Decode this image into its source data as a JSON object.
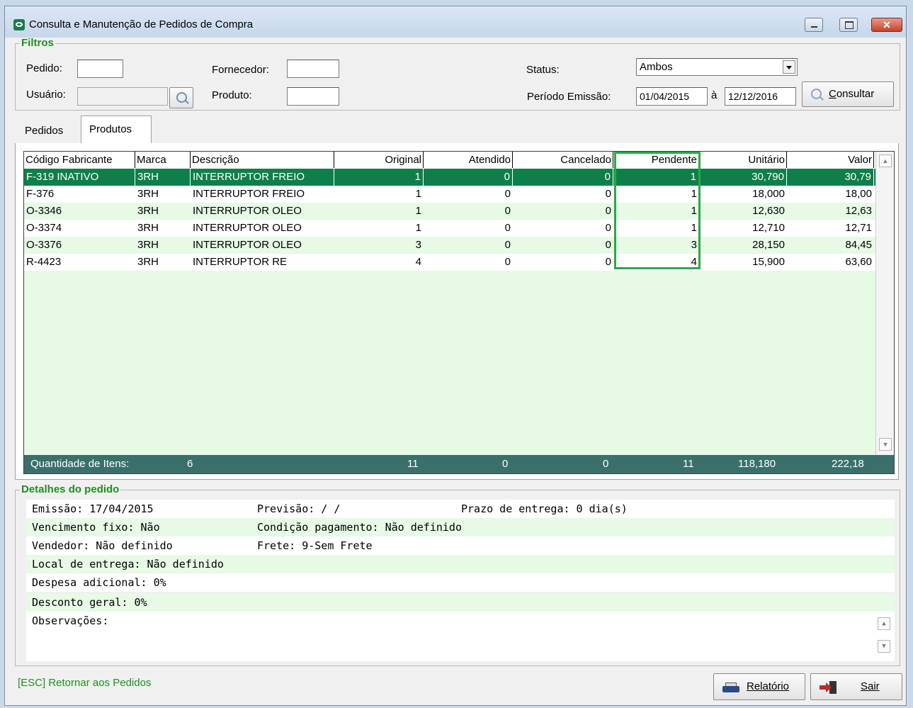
{
  "window": {
    "title": "Consulta e Manutenção de Pedidos de Compra",
    "minimize_glyph": "—",
    "maximize_glyph": "□",
    "close_glyph": "✕"
  },
  "filters": {
    "group_title": "Filtros",
    "pedido_label": "Pedido:",
    "pedido_value": "",
    "fornecedor_label": "Fornecedor:",
    "fornecedor_value": "",
    "status_label": "Status:",
    "status_value": "Ambos",
    "usuario_label": "Usuário:",
    "usuario_value": "",
    "produto_label": "Produto:",
    "produto_value": "",
    "periodo_label": "Período Emissão:",
    "periodo_from": "01/04/2015",
    "periodo_sep": "à",
    "periodo_to": "12/12/2016",
    "consultar_label": "Consultar",
    "consultar_mnemonic": "C",
    "consultar_rest": "onsultar"
  },
  "tabs": {
    "pedidos": "Pedidos",
    "produtos": "Produtos",
    "active": "produtos"
  },
  "grid": {
    "columns": [
      "Código Fabricante",
      "Marca",
      "Descrição",
      "Original",
      "Atendido",
      "Cancelado",
      "Pendente",
      "Unitário",
      "Valor"
    ],
    "rows": [
      {
        "codigo": "F-319 INATIVO",
        "marca": "3RH",
        "descricao": "INTERRUPTOR FREIO",
        "original": "1",
        "atendido": "0",
        "cancelado": "0",
        "pendente": "1",
        "unitario": "30,790",
        "valor": "30,79"
      },
      {
        "codigo": "F-376",
        "marca": "3RH",
        "descricao": "INTERRUPTOR FREIO",
        "original": "1",
        "atendido": "0",
        "cancelado": "0",
        "pendente": "1",
        "unitario": "18,000",
        "valor": "18,00"
      },
      {
        "codigo": "O-3346",
        "marca": "3RH",
        "descricao": "INTERRUPTOR OLEO",
        "original": "1",
        "atendido": "0",
        "cancelado": "0",
        "pendente": "1",
        "unitario": "12,630",
        "valor": "12,63"
      },
      {
        "codigo": "O-3374",
        "marca": "3RH",
        "descricao": "INTERRUPTOR OLEO",
        "original": "1",
        "atendido": "0",
        "cancelado": "0",
        "pendente": "1",
        "unitario": "12,710",
        "valor": "12,71"
      },
      {
        "codigo": "O-3376",
        "marca": "3RH",
        "descricao": "INTERRUPTOR OLEO",
        "original": "3",
        "atendido": "0",
        "cancelado": "0",
        "pendente": "3",
        "unitario": "28,150",
        "valor": "84,45"
      },
      {
        "codigo": "R-4423",
        "marca": "3RH",
        "descricao": "INTERRUPTOR RE",
        "original": "4",
        "atendido": "0",
        "cancelado": "0",
        "pendente": "4",
        "unitario": "15,900",
        "valor": "63,60"
      }
    ],
    "selected_row": 0,
    "totals": {
      "label": "Quantidade de Itens:",
      "count": "6",
      "original": "11",
      "atendido": "0",
      "cancelado": "0",
      "pendente": "11",
      "unitario": "118,180",
      "valor": "222,18"
    },
    "highlight_color": "#2aa84a",
    "selected_color": "#0f7f4a"
  },
  "details": {
    "group_title": "Detalhes do pedido",
    "emissao": "Emissão: 17/04/2015",
    "previsao": "Previsão:  /  /",
    "prazo": "Prazo de entrega: 0 dia(s)",
    "vencimento": "Vencimento fixo: Não",
    "condicao": "Condição pagamento: Não definido",
    "vendedor": "Vendedor: Não definido",
    "frete": "Frete: 9-Sem Frete",
    "local": "Local de entrega: Não definido",
    "despesa": "Despesa adicional: 0%",
    "desconto": "Desconto geral: 0%",
    "observacoes": "Observações:"
  },
  "bottom": {
    "esc_hint": "[ESC] Retornar aos Pedidos",
    "relatorio_label": "Relatório",
    "sair_label": "Sair"
  }
}
